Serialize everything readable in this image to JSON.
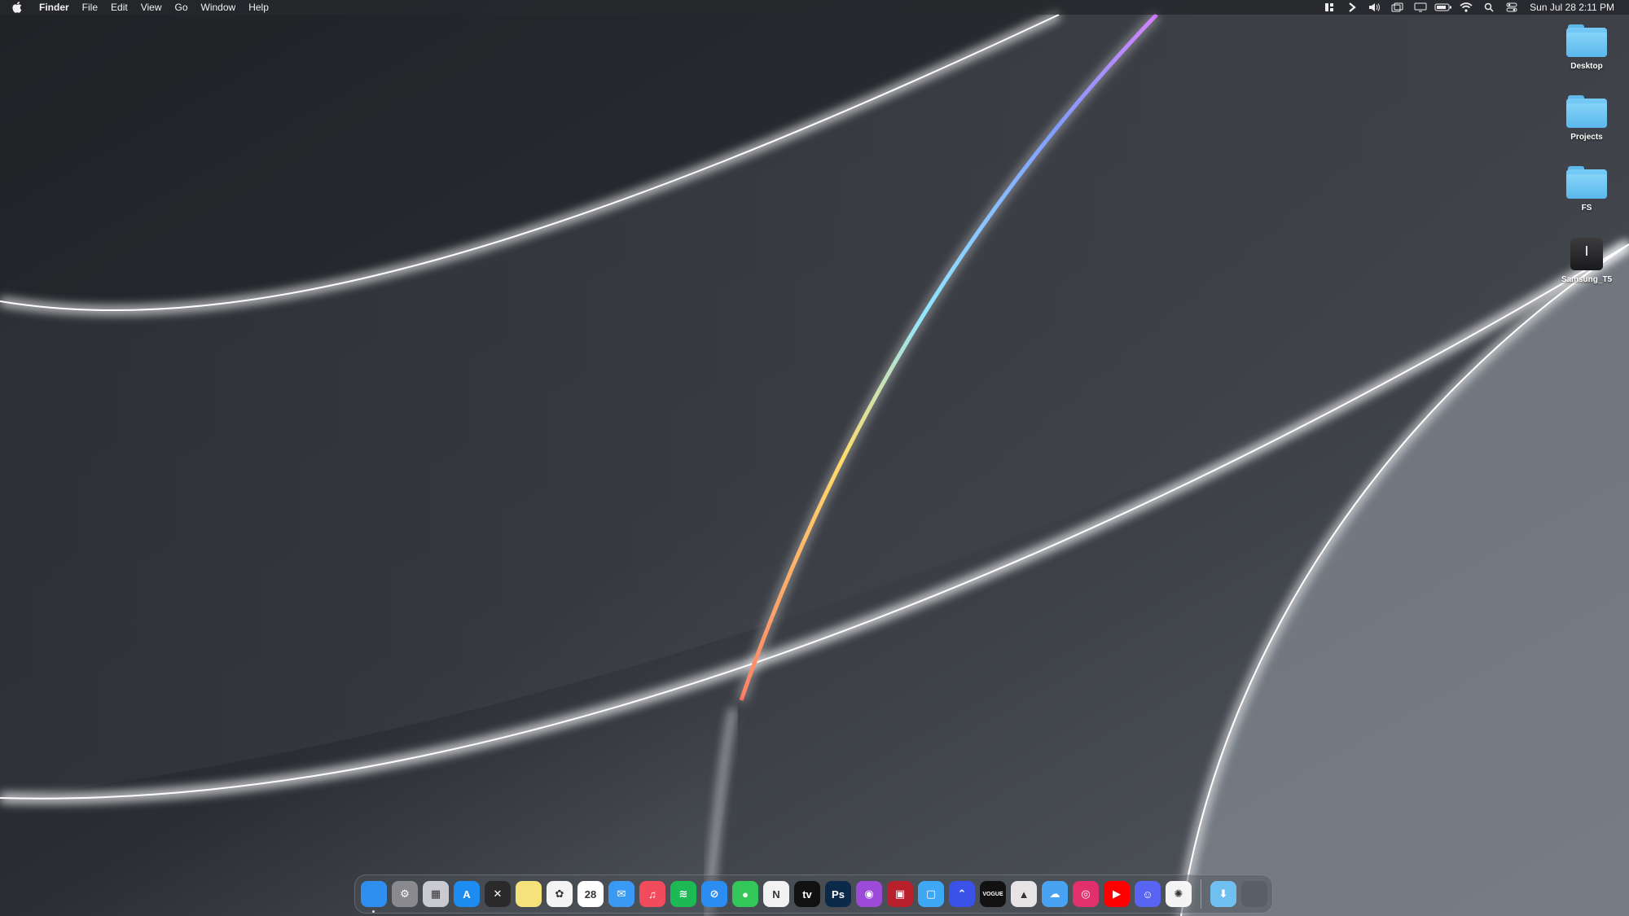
{
  "menubar": {
    "app_name": "Finder",
    "menus": [
      "File",
      "Edit",
      "View",
      "Go",
      "Window",
      "Help"
    ],
    "status_icons": [
      "grid-icon",
      "chevron-icon",
      "volume-icon",
      "screens-icon",
      "display-icon",
      "battery-icon",
      "wifi-icon",
      "search-icon",
      "control-center-icon"
    ],
    "clock": "Sun Jul 28  2:11 PM"
  },
  "desktop": {
    "items": [
      {
        "label": "Desktop",
        "icon": "folder-icon"
      },
      {
        "label": "Projects",
        "icon": "folder-icon"
      },
      {
        "label": "FS",
        "icon": "folder-icon"
      },
      {
        "label": "Samsung_T5",
        "icon": "external-drive-icon"
      }
    ]
  },
  "dock": {
    "apps": [
      {
        "name": "finder",
        "glyph": "",
        "bg": "#2f8ff0",
        "running": true
      },
      {
        "name": "system-settings",
        "glyph": "⚙",
        "bg": "#8a8a8e"
      },
      {
        "name": "launchpad",
        "glyph": "▦",
        "bg": "#c9c9d0"
      },
      {
        "name": "app-store",
        "glyph": "A",
        "bg": "#1c8cf0"
      },
      {
        "name": "tes",
        "glyph": "✕",
        "bg": "#2a2a2a"
      },
      {
        "name": "notes",
        "glyph": "",
        "bg": "#f6e27a"
      },
      {
        "name": "photos",
        "glyph": "✿",
        "bg": "#f4f4f4"
      },
      {
        "name": "calendar",
        "glyph": "28",
        "bg": "#ffffff"
      },
      {
        "name": "mail",
        "glyph": "✉",
        "bg": "#3a9af3"
      },
      {
        "name": "music",
        "glyph": "♫",
        "bg": "#f24b5c"
      },
      {
        "name": "spotify",
        "glyph": "≋",
        "bg": "#1db954"
      },
      {
        "name": "safari",
        "glyph": "⊘",
        "bg": "#2b8cf2"
      },
      {
        "name": "messages",
        "glyph": "●",
        "bg": "#33c759"
      },
      {
        "name": "news",
        "glyph": "N",
        "bg": "#f2f2f2"
      },
      {
        "name": "apple-tv",
        "glyph": "tv",
        "bg": "#111111"
      },
      {
        "name": "photoshop",
        "glyph": "Ps",
        "bg": "#0b2a4a"
      },
      {
        "name": "podcasts",
        "glyph": "◉",
        "bg": "#9b4bd8"
      },
      {
        "name": "photo-booth",
        "glyph": "▣",
        "bg": "#b8202c"
      },
      {
        "name": "preview",
        "glyph": "▢",
        "bg": "#3fa8f5"
      },
      {
        "name": "navigator",
        "glyph": "⌃",
        "bg": "#3a52e8"
      },
      {
        "name": "vogue",
        "glyph": "VOGUE",
        "bg": "#111111"
      },
      {
        "name": "affinity",
        "glyph": "▲",
        "bg": "#e8e4e6"
      },
      {
        "name": "weather",
        "glyph": "☁",
        "bg": "#4aa3f2"
      },
      {
        "name": "instagram",
        "glyph": "◎",
        "bg": "#e1306c"
      },
      {
        "name": "youtube",
        "glyph": "▶",
        "bg": "#ff0000"
      },
      {
        "name": "discord",
        "glyph": "☺",
        "bg": "#5865f2"
      },
      {
        "name": "chatgpt",
        "glyph": "✺",
        "bg": "#f4f4f4"
      }
    ],
    "utilities": [
      {
        "name": "downloads-folder",
        "glyph": "⬇",
        "bg": "#6fbff0"
      },
      {
        "name": "trash",
        "glyph": "",
        "bg": "#5a5e66"
      }
    ]
  },
  "colors": {
    "accent": "#2f8ff0",
    "menubar_text": "#f2f2f2"
  }
}
